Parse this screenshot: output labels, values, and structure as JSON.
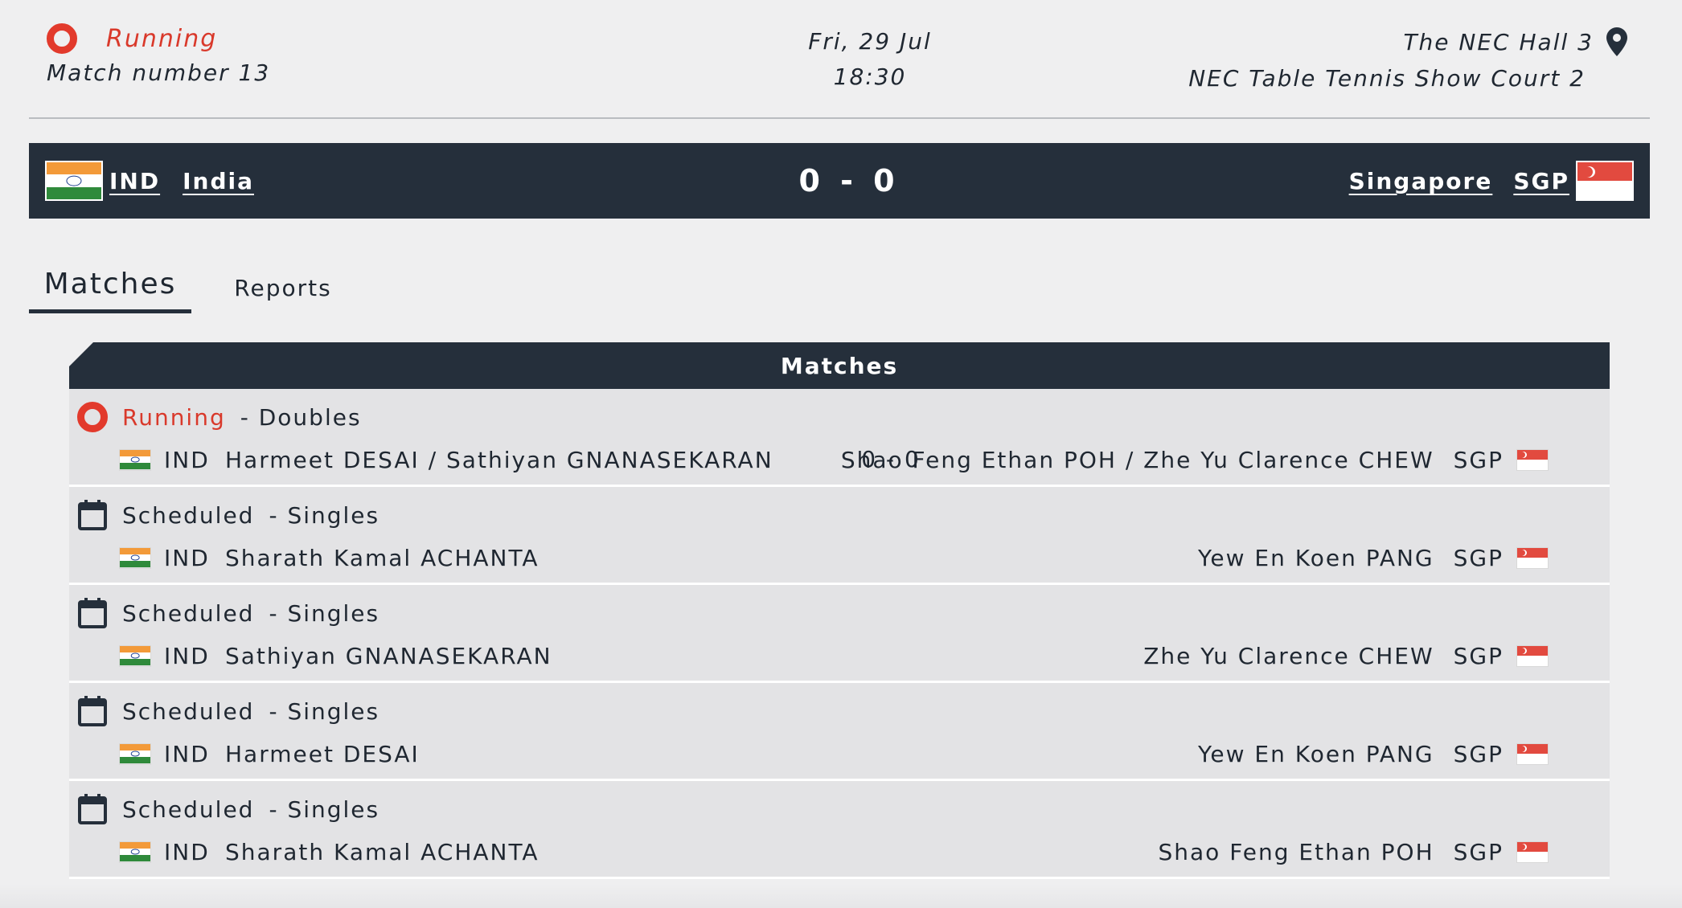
{
  "header": {
    "status": "Running",
    "match_number": "Match number 13",
    "date": "Fri, 29 Jul",
    "time": "18:30",
    "venue": "The NEC Hall 3",
    "court": "NEC Table Tennis Show Court 2"
  },
  "scoreboard": {
    "home_code": "IND",
    "home_name": "India",
    "score": "0 - 0",
    "away_name": "Singapore",
    "away_code": "SGP"
  },
  "tabs": [
    {
      "label": "Matches",
      "active": true
    },
    {
      "label": "Reports",
      "active": false
    }
  ],
  "matches": {
    "title": "Matches",
    "rows": [
      {
        "status": "Running",
        "type": "- Doubles",
        "home_code": "IND",
        "home_players": "Harmeet DESAI / Sathiyan GNANASEKARAN",
        "score": "0 - 0",
        "away_players": "Shao Feng Ethan POH / Zhe Yu Clarence CHEW",
        "away_code": "SGP"
      },
      {
        "status": "Scheduled",
        "type": "- Singles",
        "home_code": "IND",
        "home_players": "Sharath Kamal ACHANTA",
        "score": "",
        "away_players": "Yew En Koen PANG",
        "away_code": "SGP"
      },
      {
        "status": "Scheduled",
        "type": "- Singles",
        "home_code": "IND",
        "home_players": "Sathiyan GNANASEKARAN",
        "score": "",
        "away_players": "Zhe Yu Clarence CHEW",
        "away_code": "SGP"
      },
      {
        "status": "Scheduled",
        "type": "- Singles",
        "home_code": "IND",
        "home_players": "Harmeet DESAI",
        "score": "",
        "away_players": "Yew En Koen PANG",
        "away_code": "SGP"
      },
      {
        "status": "Scheduled",
        "type": "- Singles",
        "home_code": "IND",
        "home_players": "Sharath Kamal ACHANTA",
        "score": "",
        "away_players": "Shao Feng Ethan POH",
        "away_code": "SGP"
      }
    ]
  },
  "icons": {
    "running": "running-status-icon",
    "scheduled": "calendar-icon",
    "venue": "map-pin-icon",
    "home_flag": "india-flag-icon",
    "away_flag": "singapore-flag-icon"
  },
  "colors": {
    "accent_red": "#e23a2c",
    "bar_dark": "#252f3b",
    "row_bg": "#e3e3e5",
    "page_bg": "#efeff0"
  }
}
